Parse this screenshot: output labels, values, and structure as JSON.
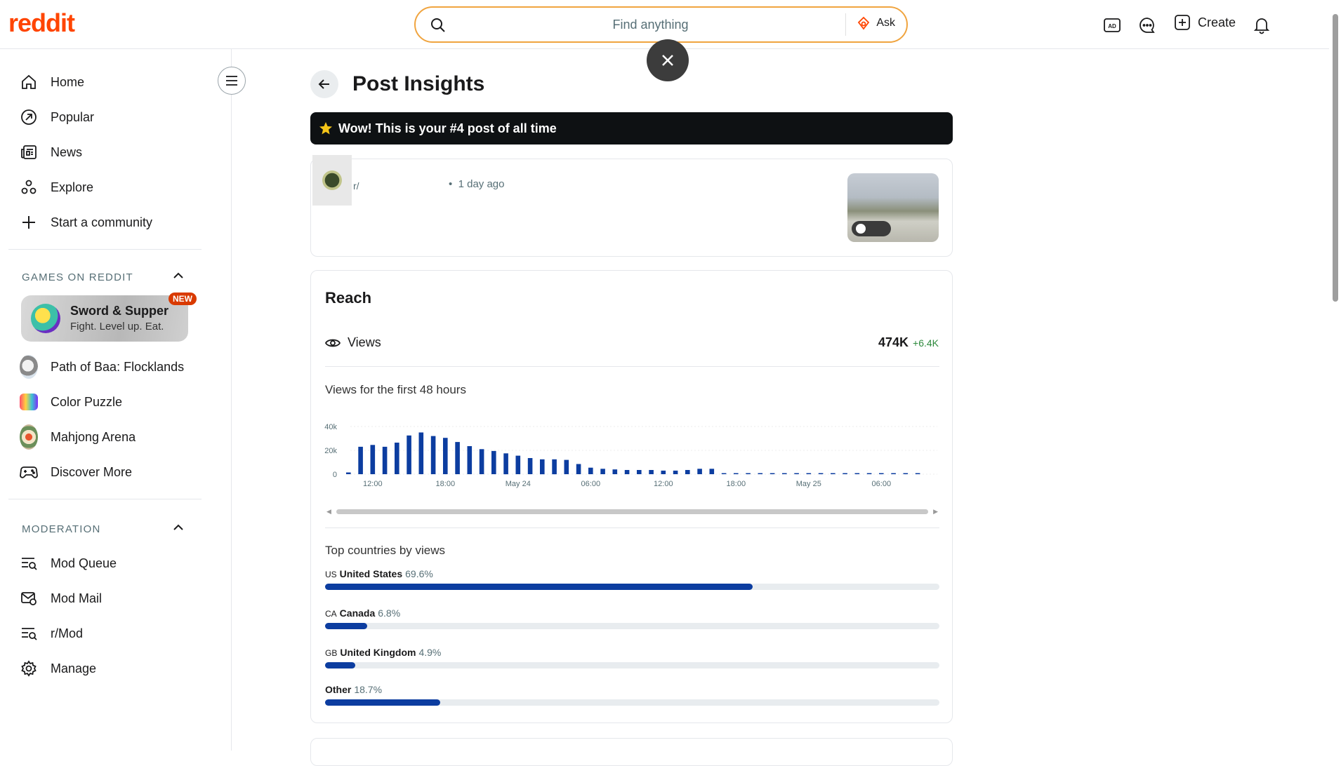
{
  "header": {
    "logo": "reddit",
    "search_placeholder": "Find anything",
    "ask_label": "Ask",
    "create_label": "Create"
  },
  "sidebar": {
    "nav": [
      {
        "label": "Home",
        "icon": "home-icon"
      },
      {
        "label": "Popular",
        "icon": "popular-icon"
      },
      {
        "label": "News",
        "icon": "news-icon"
      },
      {
        "label": "Explore",
        "icon": "explore-icon"
      },
      {
        "label": "Start a community",
        "icon": "plus-icon"
      }
    ],
    "games_title": "GAMES ON REDDIT",
    "featured_game": {
      "title": "Sword & Supper",
      "subtitle": "Fight. Level up. Eat.",
      "badge": "NEW"
    },
    "games": [
      {
        "label": "Path of Baa: Flocklands"
      },
      {
        "label": "Color Puzzle"
      },
      {
        "label": "Mahjong Arena"
      },
      {
        "label": "Discover More"
      }
    ],
    "moderation_title": "MODERATION",
    "moderation": [
      {
        "label": "Mod Queue"
      },
      {
        "label": "Mod Mail"
      },
      {
        "label": "r/Mod"
      },
      {
        "label": "Manage"
      }
    ]
  },
  "main": {
    "title": "Post Insights",
    "banner": "Wow! This is your #4 post of all time",
    "post": {
      "subreddit": "r/",
      "time": "1 day ago"
    },
    "reach": {
      "title": "Reach",
      "views_label": "Views",
      "views_value": "474K",
      "views_delta": "+6.4K",
      "chart_label": "Views for the first 48 hours"
    },
    "countries_title": "Top countries by views",
    "countries": [
      {
        "code": "US",
        "name": "United States",
        "pct_label": "69.6%",
        "pct": 69.6
      },
      {
        "code": "CA",
        "name": "Canada",
        "pct_label": "6.8%",
        "pct": 6.8
      },
      {
        "code": "GB",
        "name": "United Kingdom",
        "pct_label": "4.9%",
        "pct": 4.9
      },
      {
        "code": "",
        "name": "Other",
        "pct_label": "18.7%",
        "pct": 18.7
      }
    ]
  },
  "colors": {
    "accent": "#ff4500",
    "bar": "#0c3da0",
    "positive": "#2e8a3d"
  },
  "chart_data": {
    "type": "bar",
    "title": "Views for the first 48 hours",
    "ylim": [
      0,
      40000
    ],
    "yticks": [
      "0",
      "20k",
      "40k"
    ],
    "xticks": [
      "12:00",
      "18:00",
      "May 24",
      "06:00",
      "12:00",
      "18:00",
      "May 25",
      "06:00"
    ],
    "values": [
      1500,
      23000,
      24500,
      23000,
      26500,
      32500,
      35000,
      32000,
      30500,
      27000,
      23500,
      21000,
      19500,
      17500,
      15500,
      13500,
      12500,
      12500,
      12000,
      8500,
      5500,
      4500,
      4000,
      3500,
      3500,
      3500,
      3000,
      3000,
      3500,
      4500,
      4500,
      300,
      300,
      300,
      300,
      300,
      300,
      300,
      300,
      300,
      300,
      300,
      300,
      300,
      300,
      300,
      300,
      300
    ]
  }
}
